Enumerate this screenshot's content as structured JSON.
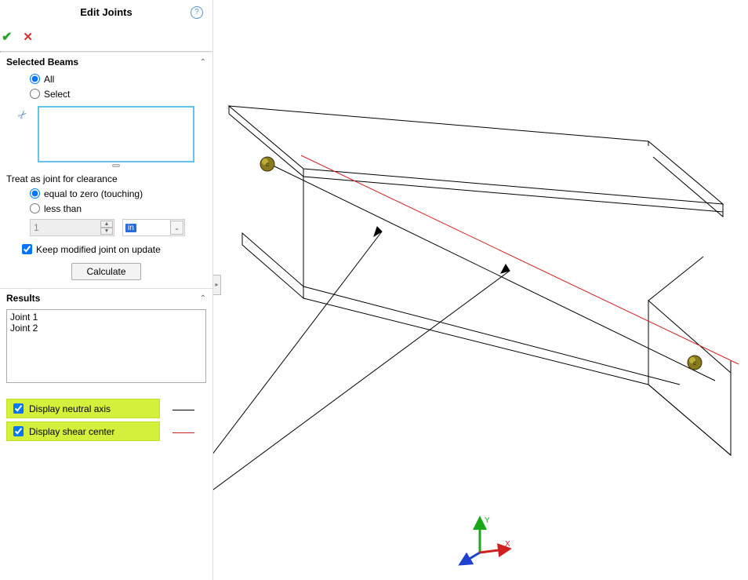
{
  "header": {
    "title": "Edit Joints",
    "help_tooltip": "?"
  },
  "actions": {
    "ok": "✔",
    "cancel": "✕"
  },
  "selected_beams": {
    "title": "Selected Beams",
    "radio_all": "All",
    "radio_select": "Select",
    "selected_value": "all"
  },
  "clearance": {
    "treat_label": "Treat as joint for clearance",
    "radio_zero": "equal to zero (touching)",
    "radio_less": "less than",
    "selected_value": "zero",
    "num_value": "1",
    "unit_value": "in",
    "keep_modified": "Keep modified joint on update",
    "keep_checked": true,
    "calculate": "Calculate"
  },
  "results": {
    "title": "Results",
    "items": [
      "Joint 1",
      "Joint 2"
    ]
  },
  "display": {
    "neutral_axis": "Display neutral axis",
    "neutral_checked": true,
    "shear_center": "Display shear center",
    "shear_checked": true
  },
  "triad": {
    "x": "X",
    "y": "Y"
  }
}
